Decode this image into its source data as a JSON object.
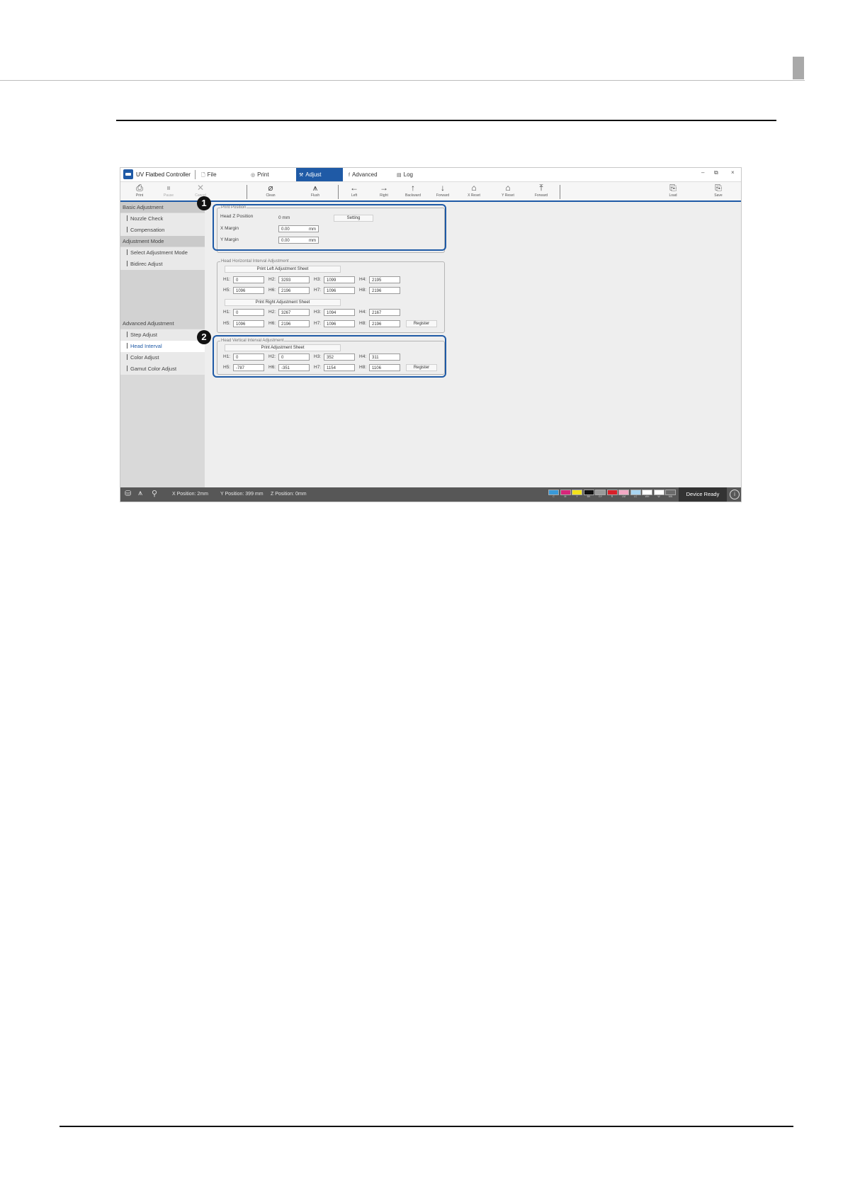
{
  "window": {
    "title": "UV Flatbed Controller"
  },
  "menu_tabs": [
    {
      "label": "File",
      "icon": "file-icon"
    },
    {
      "label": "Print",
      "icon": "print-icon"
    },
    {
      "label": "Adjust",
      "icon": "adjust-icon"
    },
    {
      "label": "Advanced",
      "icon": "advanced-icon"
    },
    {
      "label": "Log",
      "icon": "log-icon"
    }
  ],
  "active_tab": "Adjust",
  "window_controls": {
    "minimize": "–",
    "restore": "⧉",
    "close": "×"
  },
  "toolbar": [
    {
      "label": "Print",
      "icon": "⎙"
    },
    {
      "label": "Pause",
      "icon": "⏸"
    },
    {
      "label": "Cancel",
      "icon": "✕"
    },
    {
      "label": "Clean",
      "icon": "⌀"
    },
    {
      "label": "Flush",
      "icon": "⩚"
    },
    {
      "label": "Left",
      "icon": "←"
    },
    {
      "label": "Right",
      "icon": "→"
    },
    {
      "label": "Backward",
      "icon": "↑"
    },
    {
      "label": "Forward",
      "icon": "↓"
    },
    {
      "label": "X Reset",
      "icon": "⌂"
    },
    {
      "label": "Y Reset",
      "icon": "⌂"
    },
    {
      "label": "Forward",
      "icon": "⤒"
    },
    {
      "label": "Load",
      "icon": "⎘"
    },
    {
      "label": "Save",
      "icon": "⎘"
    }
  ],
  "sidebar": {
    "basic_heading": "Basic Adjustment",
    "basic_items": [
      "Nozzle Check",
      "Compensation"
    ],
    "mode_heading": "Adjustment Mode",
    "mode_items": [
      "Select Adjustment Mode",
      "Bidirec Adjust"
    ],
    "advanced_heading": "Advanced Adjustment",
    "advanced_items": [
      "Step Adjust",
      "Head Interval",
      "Color Adjust",
      "Gamut Color Adjust"
    ]
  },
  "print_position": {
    "legend": "Print Position",
    "head_z_label": "Head Z Position",
    "head_z_value": "0 mm",
    "setting_button": "Setting",
    "x_margin_label": "X Margin",
    "x_margin_value": "0.00",
    "y_margin_label": "Y Margin",
    "y_margin_value": "0.00",
    "unit": "mm"
  },
  "horizontal": {
    "legend": "Head Horizontal Interval Adjustment",
    "left_button": "Print Left Adjustment Sheet",
    "left_row1": [
      {
        "label": "H1:",
        "value": "0"
      },
      {
        "label": "H2:",
        "value": "3293"
      },
      {
        "label": "H3:",
        "value": "1099"
      },
      {
        "label": "H4:",
        "value": "2195"
      }
    ],
    "left_row2": [
      {
        "label": "H5:",
        "value": "1096"
      },
      {
        "label": "H6:",
        "value": "2196"
      },
      {
        "label": "H7:",
        "value": "1096"
      },
      {
        "label": "H8:",
        "value": "2196"
      }
    ],
    "right_button": "Print Right Adjustment Sheet",
    "right_row1": [
      {
        "label": "H1:",
        "value": "0"
      },
      {
        "label": "H2:",
        "value": "3267"
      },
      {
        "label": "H3:",
        "value": "1094"
      },
      {
        "label": "H4:",
        "value": "2167"
      }
    ],
    "right_row2": [
      {
        "label": "H5:",
        "value": "1096"
      },
      {
        "label": "H6:",
        "value": "2196"
      },
      {
        "label": "H7:",
        "value": "1096"
      },
      {
        "label": "H8:",
        "value": "2196"
      }
    ],
    "register_button": "Register"
  },
  "vertical": {
    "legend": "Head Vertical Interval Adjustment",
    "print_button": "Print Adjustment Sheet",
    "row1": [
      {
        "label": "H1:",
        "value": "0"
      },
      {
        "label": "H2:",
        "value": "0"
      },
      {
        "label": "H3:",
        "value": "352"
      },
      {
        "label": "H4:",
        "value": "311"
      }
    ],
    "row2": [
      {
        "label": "H5:",
        "value": "-787"
      },
      {
        "label": "H6:",
        "value": "-351"
      },
      {
        "label": "H7:",
        "value": "1154"
      },
      {
        "label": "H8:",
        "value": "1106"
      }
    ],
    "register_button": "Register"
  },
  "callouts": [
    "1",
    "2"
  ],
  "status_bar": {
    "x_position": "X Position: 2mm",
    "y_position": "Y Position: 399 mm",
    "z_position": "Z Position: 0mm",
    "device_status": "Device Ready",
    "info_icon": "i"
  },
  "inks": [
    {
      "label": "C",
      "color": "#3a9ad9"
    },
    {
      "label": "M",
      "color": "#d6267a"
    },
    {
      "label": "Y",
      "color": "#f2e21c"
    },
    {
      "label": "BK",
      "color": "#111111"
    },
    {
      "label": "GY",
      "color": "#9a9a9a"
    },
    {
      "label": "R",
      "color": "#d9202a"
    },
    {
      "label": "LM",
      "color": "#f2a8c4"
    },
    {
      "label": "LC",
      "color": "#a9d4f0"
    },
    {
      "label": "WH",
      "color": "#ffffff"
    },
    {
      "label": "W",
      "color": "#ffffff"
    },
    {
      "label": "MN",
      "color": "#6b6b6b"
    }
  ]
}
